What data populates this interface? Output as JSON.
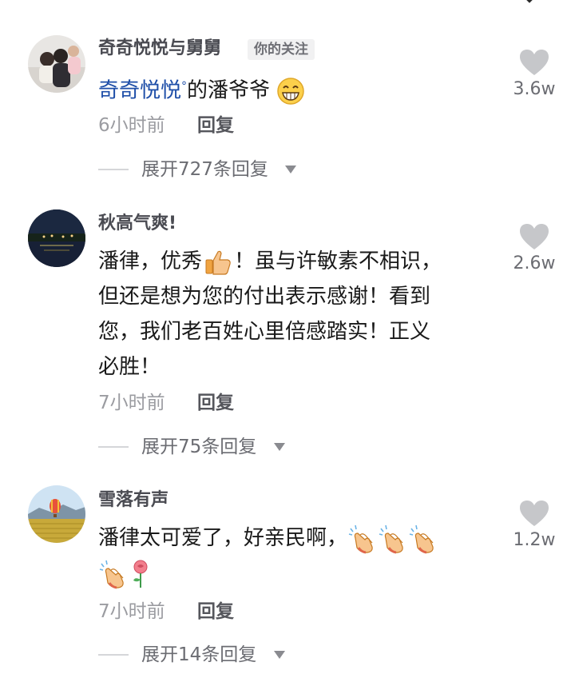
{
  "comments": [
    {
      "username": "奇奇悦悦与舅舅",
      "follow_tag": "你的关注",
      "mention": "奇奇悦悦",
      "text_after_mention": "的潘爷爷",
      "emoji": "grin-face-icon",
      "time": "6小时前",
      "reply_label": "回复",
      "expand_label": "展开727条回复",
      "like_count": "3.6w",
      "avatar": "family-photo-avatar"
    },
    {
      "username": "秋高气爽!",
      "text_lines": [
        "潘律，优秀",
        "！虽与许敏素不相识，",
        "但还是想为您的付出表示感谢！看到",
        "您，我们老百姓心里倍感踏实！正义",
        "必胜！"
      ],
      "emoji": "thumbs-up-icon",
      "time": "7小时前",
      "reply_label": "回复",
      "expand_label": "展开75条回复",
      "like_count": "2.6w",
      "avatar": "night-lake-avatar"
    },
    {
      "username": "雪落有声",
      "text": "潘律太可爱了，好亲民啊，",
      "emojis": [
        "clapping-hands-icon",
        "clapping-hands-icon",
        "clapping-hands-icon",
        "clapping-hands-icon",
        "rose-icon"
      ],
      "time": "7小时前",
      "reply_label": "回复",
      "expand_label": "展开14条回复",
      "like_count": "1.2w",
      "avatar": "balloon-field-avatar"
    }
  ],
  "colors": {
    "mention": "#1e4ea8",
    "like_heart": "#c6c7ca",
    "meta_gray": "#9b9ca1"
  }
}
